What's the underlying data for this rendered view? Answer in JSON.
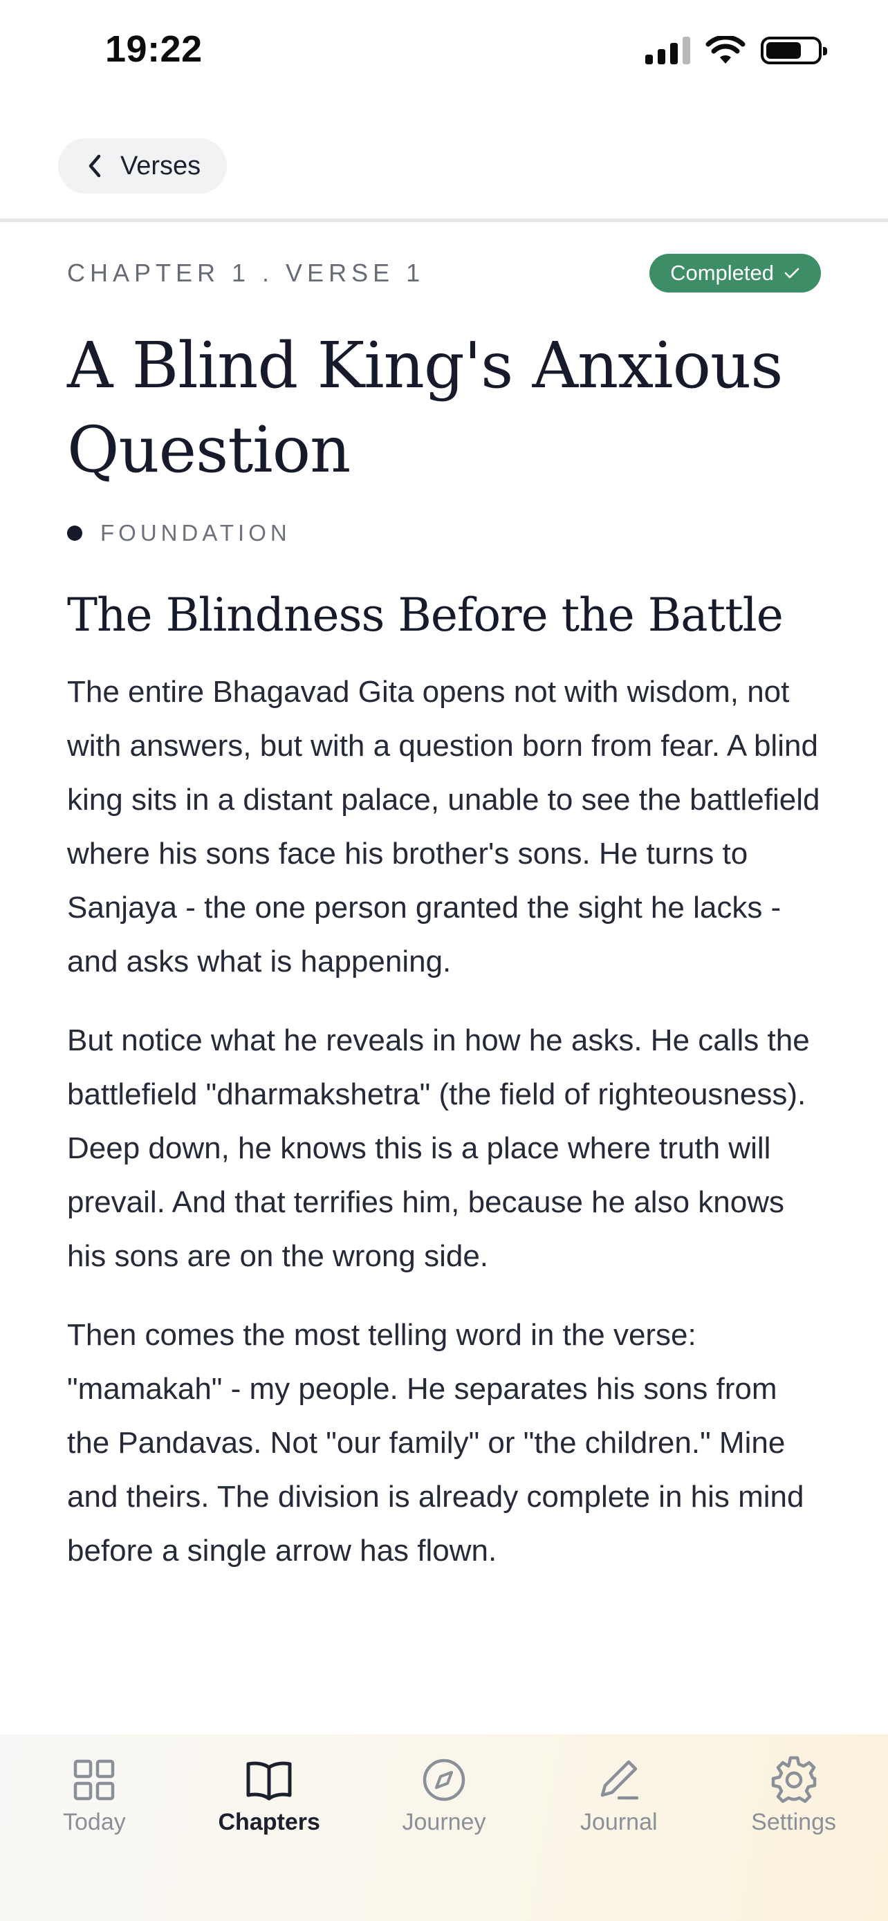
{
  "status_bar": {
    "time": "19:22"
  },
  "header": {
    "back_label": "Verses"
  },
  "verse": {
    "chapter_label": "CHAPTER 1 . VERSE 1",
    "status": "Completed",
    "title": "A Blind King's Anxious Question",
    "category": "FOUNDATION",
    "section_heading": "The Blindness Before the Battle",
    "paragraphs": [
      "The entire Bhagavad Gita opens not with wisdom, not with answers, but with a question born from fear. A blind king sits in a distant palace, unable to see the battlefield where his sons face his brother's sons. He turns to Sanjaya - the one person granted the sight he lacks - and asks what is happening.",
      "But notice what he reveals in how he asks. He calls the battlefield \"dharmakshetra\" (the field of righteousness). Deep down, he knows this is a place where truth will prevail. And that terrifies him, because he also knows his sons are on the wrong side.",
      "Then comes the most telling word in the verse: \"mamakah\" - my people. He separates his sons from the Pandavas. Not \"our family\" or \"the children.\" Mine and theirs. The division is already complete in his mind before a single arrow has flown."
    ]
  },
  "tab_bar": {
    "tabs": [
      {
        "label": "Today",
        "icon": "grid-icon",
        "active": false
      },
      {
        "label": "Chapters",
        "icon": "open-book-icon",
        "active": true
      },
      {
        "label": "Journey",
        "icon": "compass-icon",
        "active": false
      },
      {
        "label": "Journal",
        "icon": "pencil-icon",
        "active": false
      },
      {
        "label": "Settings",
        "icon": "gear-icon",
        "active": false
      }
    ]
  },
  "colors": {
    "badge_green": "#3d8d66",
    "title_ink": "#161a2b",
    "muted_text": "#666b76",
    "tab_inactive": "#8a8f98"
  }
}
